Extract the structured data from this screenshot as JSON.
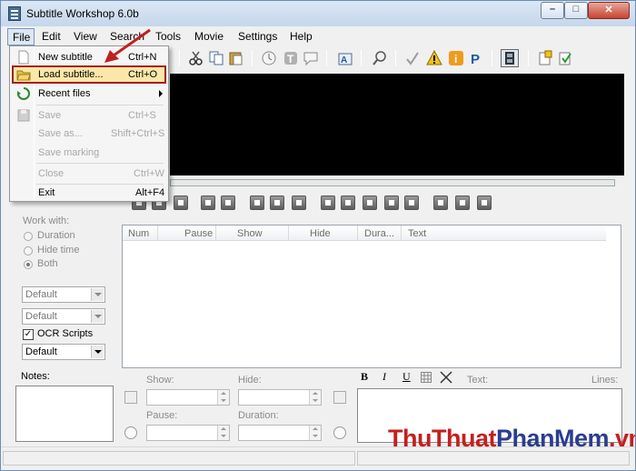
{
  "window": {
    "title": "Subtitle Workshop 6.0b"
  },
  "menubar": [
    "File",
    "Edit",
    "View",
    "Search",
    "Tools",
    "Movie",
    "Settings",
    "Help"
  ],
  "file_menu": {
    "items": [
      {
        "label": "New subtitle",
        "shortcut": "Ctrl+N",
        "enabled": true
      },
      {
        "label": "Load subtitle...",
        "shortcut": "Ctrl+O",
        "enabled": true,
        "highlighted": true
      },
      {
        "label": "Recent files",
        "shortcut": "",
        "enabled": true,
        "submenu": true
      },
      {
        "label": "Save",
        "shortcut": "Ctrl+S",
        "enabled": false
      },
      {
        "label": "Save as...",
        "shortcut": "Shift+Ctrl+S",
        "enabled": false
      },
      {
        "label": "Save marking",
        "shortcut": "",
        "enabled": false
      },
      {
        "label": "Close",
        "shortcut": "Ctrl+W",
        "enabled": false
      },
      {
        "label": "Exit",
        "shortcut": "Alt+F4",
        "enabled": true
      }
    ]
  },
  "left_panel": {
    "work_with_label": "Work with:",
    "radios": [
      "Duration",
      "Hide time",
      "Both"
    ],
    "selected_radio": "Both",
    "combo1": "Default",
    "combo2": "Default",
    "ocr_label": "OCR Scripts",
    "ocr_checked": true,
    "combo3": "Default",
    "notes_label": "Notes:"
  },
  "grid": {
    "columns": [
      "Num",
      "Pause",
      "Show",
      "Hide",
      "Dura...",
      "Text"
    ]
  },
  "editor": {
    "show_label": "Show:",
    "hide_label": "Hide:",
    "pause_label": "Pause:",
    "duration_label": "Duration:",
    "text_label": "Text:",
    "lines_label": "Lines:",
    "format_buttons": [
      "B",
      "I",
      "U"
    ]
  },
  "watermark": {
    "part1": "ThuThuat",
    "part2": "PhanMem",
    "part3": ".vn"
  },
  "colors": {
    "highlight_border": "#a61d1d",
    "highlight_fill": "#fbe8a9",
    "arrow": "#c0201f"
  }
}
